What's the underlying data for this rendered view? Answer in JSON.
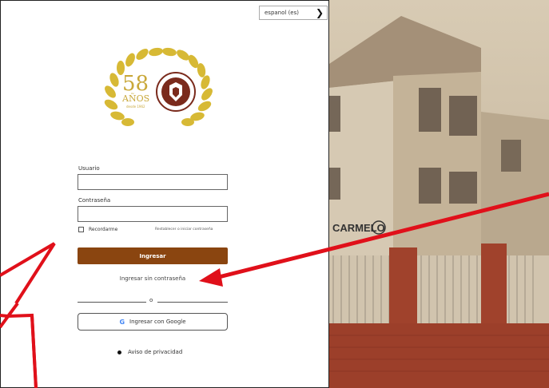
{
  "language_selector": {
    "value": "espanol (es)",
    "icon": "chevron-down-icon"
  },
  "logo": {
    "number": "58",
    "word": "AÑOS",
    "since": "desde 1962"
  },
  "form": {
    "username_label": "Usuario",
    "password_label": "Contraseña",
    "remember_label": "Recordarme",
    "forgot_text": "Restablecer o iniciar contraseña",
    "submit_label": "Ingresar",
    "passwordless_link": "Ingresar sin contraseña",
    "or_text": "o",
    "google_label": "Ingresar con Google",
    "privacy_link": "Aviso de privacidad"
  },
  "building_sign": {
    "text": "CARMELO"
  },
  "colors": {
    "primary_button": "#8a4510",
    "annotation": "#e0101a"
  }
}
